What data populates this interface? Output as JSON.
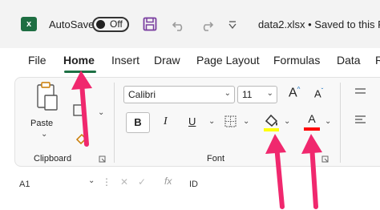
{
  "titlebar": {
    "app_icon": "excel-logo",
    "app_icon_letter": "x",
    "autosave_label": "AutoSave",
    "autosave_state": "Off",
    "file_title": "data2.xlsx • Saved to this P"
  },
  "menu": [
    "File",
    "Home",
    "Insert",
    "Draw",
    "Page Layout",
    "Formulas",
    "Data",
    "R"
  ],
  "active_tab": "Home",
  "clipboard": {
    "paste_label": "Paste",
    "group_label": "Clipboard"
  },
  "font": {
    "font_name": "Calibri",
    "font_size": "11",
    "increase_label": "A",
    "decrease_label": "A",
    "bold_label": "B",
    "italic_label": "I",
    "underline_label": "U",
    "font_color_label": "A",
    "group_label": "Font"
  },
  "formula_bar": {
    "cell_ref": "A1",
    "fx": "fx",
    "content": "ID"
  },
  "colors": {
    "highlight": "#ffff00",
    "font_color": "#ff0000",
    "arrows": "#f0286e",
    "active_underline": "#1e7145",
    "excel_green": "#1e6e42"
  }
}
